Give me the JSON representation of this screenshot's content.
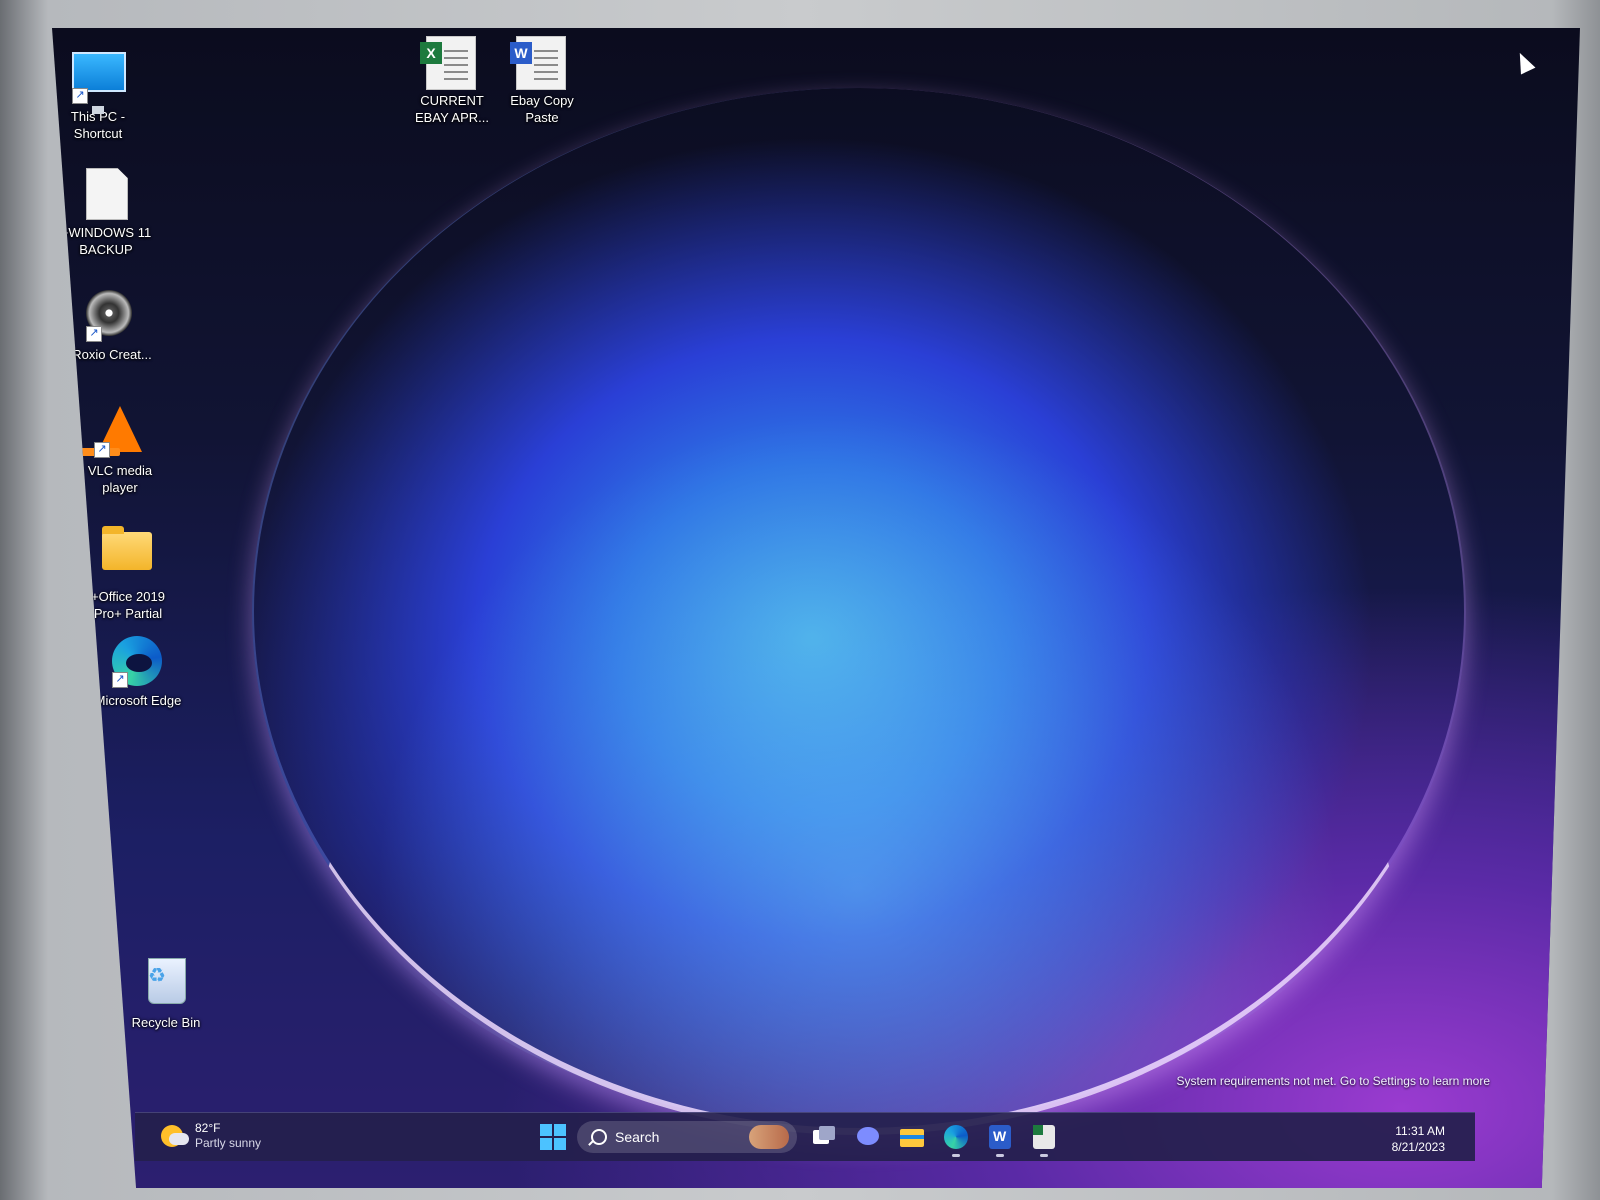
{
  "desktop": {
    "icons": [
      {
        "label": "This PC - Shortcut",
        "icon": "monitor-icon"
      },
      {
        "label": "+WINDOWS 11 BACKUP",
        "icon": "file-icon"
      },
      {
        "label": "Roxio Creat...",
        "icon": "disc-icon"
      },
      {
        "label": "VLC media player",
        "icon": "vlc-cone-icon"
      },
      {
        "label": "+Office 2019 Pro+ Partial",
        "icon": "folder-icon"
      },
      {
        "label": "Microsoft Edge",
        "icon": "edge-icon"
      },
      {
        "label": "Recycle Bin",
        "icon": "recycle-bin-icon"
      },
      {
        "label": "CURRENT EBAY APR...",
        "icon": "excel-file-icon"
      },
      {
        "label": "Ebay Copy Paste",
        "icon": "word-file-icon"
      }
    ],
    "watermark": "System requirements not met. Go to Settings to learn more"
  },
  "taskbar": {
    "weather": {
      "temp": "82°F",
      "condition": "Partly sunny"
    },
    "search_label": "Search",
    "apps": [
      "start-icon",
      "task-view-icon",
      "chat-icon",
      "file-explorer-icon",
      "edge-icon",
      "word-icon",
      "excel-icon"
    ],
    "clock": {
      "time": "11:31 AM",
      "date": "8/21/2023"
    }
  },
  "colors": {
    "accent": "#4cc2ff",
    "taskbar": "#24204c"
  }
}
